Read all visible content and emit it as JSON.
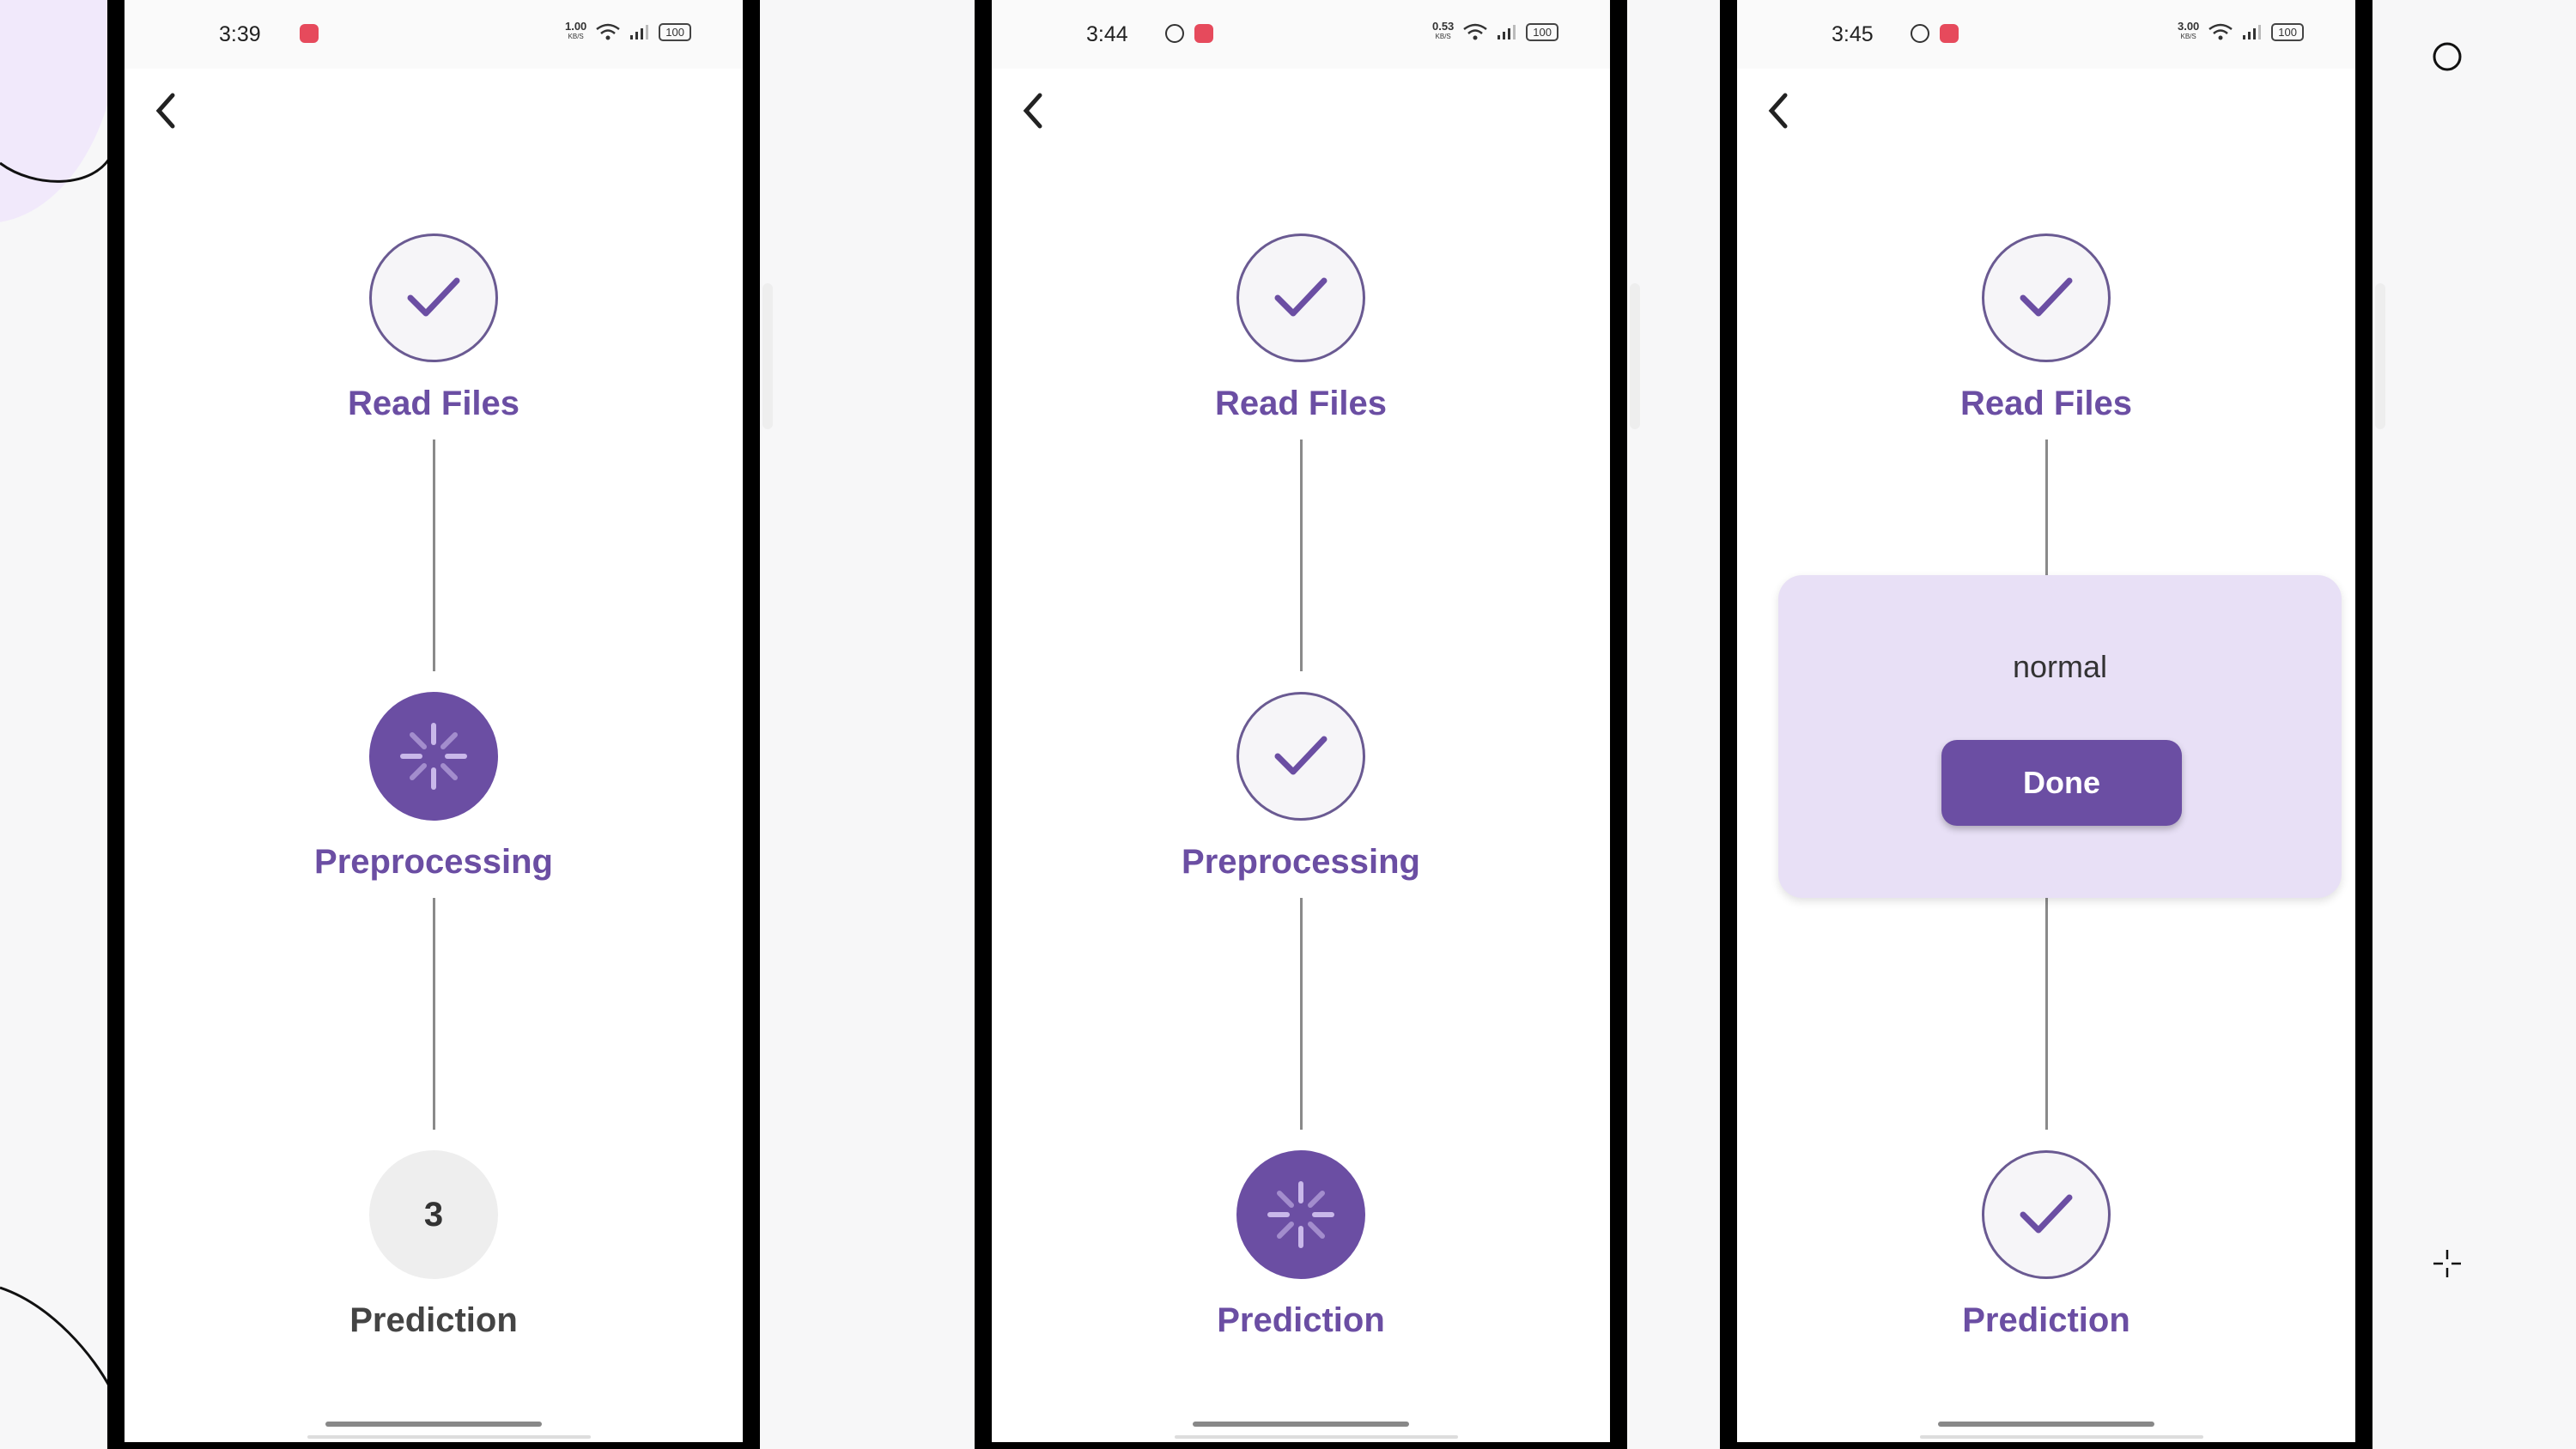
{
  "colors": {
    "accent": "#6b4ea3",
    "completed_border": "#6a5a92",
    "pending_bg": "#eeeeee",
    "card_bg": "#e8e0f6"
  },
  "phones": [
    {
      "time": "3:39",
      "net_speed": "1.00",
      "net_unit": "KB/S",
      "battery": "100",
      "steps": [
        {
          "label": "Read Files",
          "status": "completed",
          "icon": "check-icon"
        },
        {
          "label": "Preprocessing",
          "status": "in-progress",
          "icon": "spinner-icon"
        },
        {
          "label": "Prediction",
          "status": "pending",
          "number": "3"
        }
      ]
    },
    {
      "time": "3:44",
      "net_speed": "0.53",
      "net_unit": "KB/S",
      "battery": "100",
      "steps": [
        {
          "label": "Read Files",
          "status": "completed",
          "icon": "check-icon"
        },
        {
          "label": "Preprocessing",
          "status": "completed",
          "icon": "check-icon"
        },
        {
          "label": "Prediction",
          "status": "in-progress",
          "icon": "spinner-icon"
        }
      ]
    },
    {
      "time": "3:45",
      "net_speed": "3.00",
      "net_unit": "KB/S",
      "battery": "100",
      "steps": [
        {
          "label": "Read Files",
          "status": "completed",
          "icon": "check-icon"
        },
        {
          "label": "Prediction",
          "status": "completed",
          "icon": "check-icon"
        }
      ],
      "result": {
        "text": "normal",
        "button_label": "Done"
      }
    }
  ],
  "side_controls": {
    "top_icon": "circle-icon",
    "bottom_icon": "crosshair-icon"
  }
}
